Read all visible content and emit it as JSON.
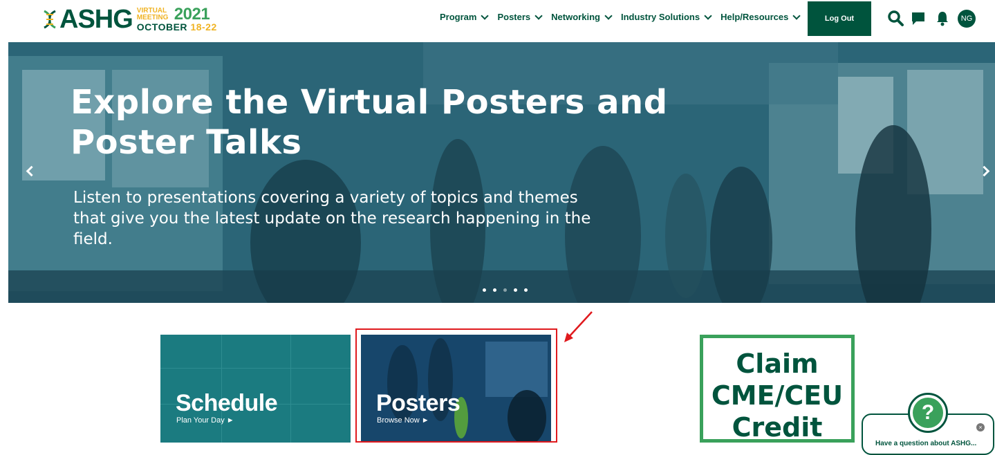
{
  "header": {
    "logo": {
      "word": "ASHG",
      "line1": "VIRTUAL MEETING",
      "year": "2021",
      "dates_month": "OCTOBER",
      "dates_days": "18-22"
    },
    "nav": [
      {
        "label": "Program"
      },
      {
        "label": "Posters"
      },
      {
        "label": "Networking"
      },
      {
        "label": "Industry Solutions"
      },
      {
        "label": "Help/Resources"
      }
    ],
    "logout_label": "Log Out",
    "icons": [
      "search-icon",
      "chat-icon",
      "bell-icon"
    ],
    "avatar_initials": "NG"
  },
  "hero": {
    "title": "Explore the Virtual Posters and Poster Talks",
    "subtitle": "Listen to presentations covering a variety of topics and themes that give you the latest update on the research happening in the field.",
    "slide_count": 5,
    "active_slide": 3
  },
  "tiles": {
    "schedule": {
      "title": "Schedule",
      "sub": "Plan Your Day ►"
    },
    "posters": {
      "title": "Posters",
      "sub": "Browse Now ►"
    }
  },
  "cme": {
    "line1": "Claim",
    "line2": "CME/CEU",
    "line3": "Credit"
  },
  "help": {
    "text": "Have a question about ASHG...",
    "badge": "?"
  },
  "colors": {
    "brand_green": "#00543d",
    "accent_green": "#3aa15b",
    "accent_yellow": "#f0b323",
    "highlight_red": "#e0191d"
  }
}
